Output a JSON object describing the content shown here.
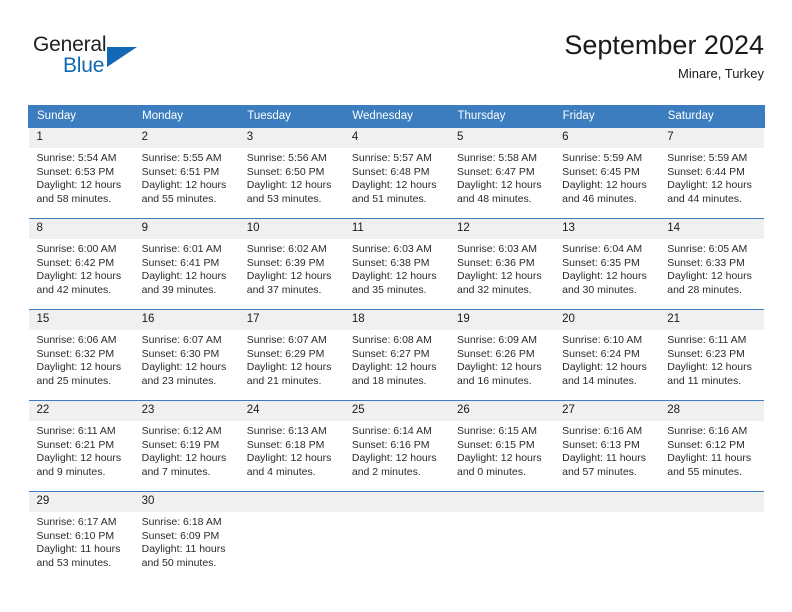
{
  "brand": {
    "line1": "General",
    "line2": "Blue",
    "flag_icon": "triangle-flag-icon",
    "accent_color": "#1268b3",
    "text_color": "#231f20"
  },
  "header": {
    "month_title": "September 2024",
    "location": "Minare, Turkey"
  },
  "theme": {
    "header_row_background": "#3b7dbf",
    "header_row_text": "#ffffff",
    "daynumber_band_background": "#f0f0f0",
    "cell_background": "#ffffff",
    "cell_divider": "#3b7dbf",
    "body_text": "#2b2b2b"
  },
  "labels": {
    "sunrise_prefix": "Sunrise:",
    "sunset_prefix": "Sunset:",
    "daylight_prefix": "Daylight:"
  },
  "columns": [
    "Sunday",
    "Monday",
    "Tuesday",
    "Wednesday",
    "Thursday",
    "Friday",
    "Saturday"
  ],
  "weeks": [
    [
      {
        "day": "1",
        "sunrise": "Sunrise: 5:54 AM",
        "sunset": "Sunset: 6:53 PM",
        "daylight": "Daylight: 12 hours and 58 minutes."
      },
      {
        "day": "2",
        "sunrise": "Sunrise: 5:55 AM",
        "sunset": "Sunset: 6:51 PM",
        "daylight": "Daylight: 12 hours and 55 minutes."
      },
      {
        "day": "3",
        "sunrise": "Sunrise: 5:56 AM",
        "sunset": "Sunset: 6:50 PM",
        "daylight": "Daylight: 12 hours and 53 minutes."
      },
      {
        "day": "4",
        "sunrise": "Sunrise: 5:57 AM",
        "sunset": "Sunset: 6:48 PM",
        "daylight": "Daylight: 12 hours and 51 minutes."
      },
      {
        "day": "5",
        "sunrise": "Sunrise: 5:58 AM",
        "sunset": "Sunset: 6:47 PM",
        "daylight": "Daylight: 12 hours and 48 minutes."
      },
      {
        "day": "6",
        "sunrise": "Sunrise: 5:59 AM",
        "sunset": "Sunset: 6:45 PM",
        "daylight": "Daylight: 12 hours and 46 minutes."
      },
      {
        "day": "7",
        "sunrise": "Sunrise: 5:59 AM",
        "sunset": "Sunset: 6:44 PM",
        "daylight": "Daylight: 12 hours and 44 minutes."
      }
    ],
    [
      {
        "day": "8",
        "sunrise": "Sunrise: 6:00 AM",
        "sunset": "Sunset: 6:42 PM",
        "daylight": "Daylight: 12 hours and 42 minutes."
      },
      {
        "day": "9",
        "sunrise": "Sunrise: 6:01 AM",
        "sunset": "Sunset: 6:41 PM",
        "daylight": "Daylight: 12 hours and 39 minutes."
      },
      {
        "day": "10",
        "sunrise": "Sunrise: 6:02 AM",
        "sunset": "Sunset: 6:39 PM",
        "daylight": "Daylight: 12 hours and 37 minutes."
      },
      {
        "day": "11",
        "sunrise": "Sunrise: 6:03 AM",
        "sunset": "Sunset: 6:38 PM",
        "daylight": "Daylight: 12 hours and 35 minutes."
      },
      {
        "day": "12",
        "sunrise": "Sunrise: 6:03 AM",
        "sunset": "Sunset: 6:36 PM",
        "daylight": "Daylight: 12 hours and 32 minutes."
      },
      {
        "day": "13",
        "sunrise": "Sunrise: 6:04 AM",
        "sunset": "Sunset: 6:35 PM",
        "daylight": "Daylight: 12 hours and 30 minutes."
      },
      {
        "day": "14",
        "sunrise": "Sunrise: 6:05 AM",
        "sunset": "Sunset: 6:33 PM",
        "daylight": "Daylight: 12 hours and 28 minutes."
      }
    ],
    [
      {
        "day": "15",
        "sunrise": "Sunrise: 6:06 AM",
        "sunset": "Sunset: 6:32 PM",
        "daylight": "Daylight: 12 hours and 25 minutes."
      },
      {
        "day": "16",
        "sunrise": "Sunrise: 6:07 AM",
        "sunset": "Sunset: 6:30 PM",
        "daylight": "Daylight: 12 hours and 23 minutes."
      },
      {
        "day": "17",
        "sunrise": "Sunrise: 6:07 AM",
        "sunset": "Sunset: 6:29 PM",
        "daylight": "Daylight: 12 hours and 21 minutes."
      },
      {
        "day": "18",
        "sunrise": "Sunrise: 6:08 AM",
        "sunset": "Sunset: 6:27 PM",
        "daylight": "Daylight: 12 hours and 18 minutes."
      },
      {
        "day": "19",
        "sunrise": "Sunrise: 6:09 AM",
        "sunset": "Sunset: 6:26 PM",
        "daylight": "Daylight: 12 hours and 16 minutes."
      },
      {
        "day": "20",
        "sunrise": "Sunrise: 6:10 AM",
        "sunset": "Sunset: 6:24 PM",
        "daylight": "Daylight: 12 hours and 14 minutes."
      },
      {
        "day": "21",
        "sunrise": "Sunrise: 6:11 AM",
        "sunset": "Sunset: 6:23 PM",
        "daylight": "Daylight: 12 hours and 11 minutes."
      }
    ],
    [
      {
        "day": "22",
        "sunrise": "Sunrise: 6:11 AM",
        "sunset": "Sunset: 6:21 PM",
        "daylight": "Daylight: 12 hours and 9 minutes."
      },
      {
        "day": "23",
        "sunrise": "Sunrise: 6:12 AM",
        "sunset": "Sunset: 6:19 PM",
        "daylight": "Daylight: 12 hours and 7 minutes."
      },
      {
        "day": "24",
        "sunrise": "Sunrise: 6:13 AM",
        "sunset": "Sunset: 6:18 PM",
        "daylight": "Daylight: 12 hours and 4 minutes."
      },
      {
        "day": "25",
        "sunrise": "Sunrise: 6:14 AM",
        "sunset": "Sunset: 6:16 PM",
        "daylight": "Daylight: 12 hours and 2 minutes."
      },
      {
        "day": "26",
        "sunrise": "Sunrise: 6:15 AM",
        "sunset": "Sunset: 6:15 PM",
        "daylight": "Daylight: 12 hours and 0 minutes."
      },
      {
        "day": "27",
        "sunrise": "Sunrise: 6:16 AM",
        "sunset": "Sunset: 6:13 PM",
        "daylight": "Daylight: 11 hours and 57 minutes."
      },
      {
        "day": "28",
        "sunrise": "Sunrise: 6:16 AM",
        "sunset": "Sunset: 6:12 PM",
        "daylight": "Daylight: 11 hours and 55 minutes."
      }
    ],
    [
      {
        "day": "29",
        "sunrise": "Sunrise: 6:17 AM",
        "sunset": "Sunset: 6:10 PM",
        "daylight": "Daylight: 11 hours and 53 minutes."
      },
      {
        "day": "30",
        "sunrise": "Sunrise: 6:18 AM",
        "sunset": "Sunset: 6:09 PM",
        "daylight": "Daylight: 11 hours and 50 minutes."
      },
      null,
      null,
      null,
      null,
      null
    ]
  ]
}
